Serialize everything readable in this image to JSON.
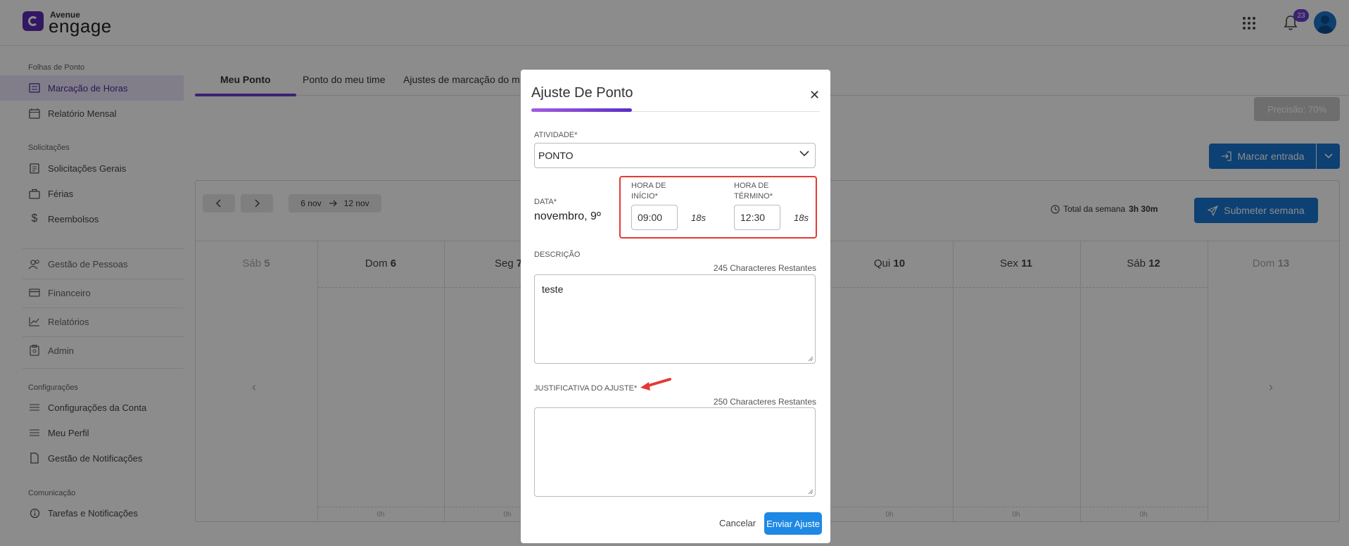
{
  "topbar": {
    "brand_small": "Avenue",
    "brand": "engage",
    "notifications_count": "23"
  },
  "sidebar": {
    "sections": [
      {
        "title": "Folhas de Ponto"
      },
      {
        "title": "Solicitações"
      },
      {
        "title": "Configurações"
      },
      {
        "title": "Comunicação"
      }
    ],
    "items": [
      {
        "label": "Marcação de Horas"
      },
      {
        "label": "Relatório Mensal"
      },
      {
        "label": "Solicitações Gerais"
      },
      {
        "label": "Férias"
      },
      {
        "label": "Reembolsos"
      },
      {
        "label": "Gestão de Pessoas"
      },
      {
        "label": "Financeiro"
      },
      {
        "label": "Relatórios"
      },
      {
        "label": "Admin"
      },
      {
        "label": "Configurações da Conta"
      },
      {
        "label": "Meu Perfil"
      },
      {
        "label": "Gestão de Notificações"
      },
      {
        "label": "Tarefas e Notificações"
      }
    ]
  },
  "main": {
    "tabs": [
      {
        "label": "Meu Ponto"
      },
      {
        "label": "Ponto do meu time"
      },
      {
        "label": "Ajustes de marcação do m"
      }
    ],
    "precisao": "Precisão: 70%",
    "marcar_entrada": "Marcar entrada",
    "range_start": "6 nov",
    "range_end": "12 nov",
    "week_total_label": "Total da semana",
    "week_total_value": "3h 30m",
    "submeter": "Submeter semana",
    "days": [
      {
        "name": "Sáb",
        "num": "5"
      },
      {
        "name": "Dom",
        "num": "6"
      },
      {
        "name": "Seg",
        "num": "7"
      },
      {
        "name": "Qui",
        "num": "10"
      },
      {
        "name": "Sex",
        "num": "11"
      },
      {
        "name": "Sáb",
        "num": "12"
      },
      {
        "name": "Dom",
        "num": "13"
      }
    ],
    "hours": [
      "0h",
      "0h",
      "0h",
      "0h",
      "0h"
    ]
  },
  "modal": {
    "title": "Ajuste De Ponto",
    "atividade_label": "ATIVIDADE*",
    "atividade_value": "PONTO",
    "data_label": "DATA*",
    "data_value": "novembro, 9º",
    "inicio_label_1": "HORA DE",
    "inicio_label_2": "INÍCIO*",
    "inicio_value": "09:00",
    "inicio_duration": "18s",
    "termino_label_1": "HORA DE",
    "termino_label_2": "TÉRMINO*",
    "termino_value": "12:30",
    "termino_duration": "18s",
    "descricao_label": "DESCRIÇÃO",
    "descricao_remaining": "245 Characteres Restantes",
    "descricao_value": "teste",
    "justificativa_label": "JUSTIFICATIVA DO AJUSTE*",
    "justificativa_remaining": "250 Characteres Restantes",
    "justificativa_value": "",
    "cancel": "Cancelar",
    "submit": "Enviar Ajuste"
  },
  "colors": {
    "brand_purple": "#6a3fd0",
    "primary_blue": "#1976d2",
    "highlight_red": "#e53935"
  }
}
